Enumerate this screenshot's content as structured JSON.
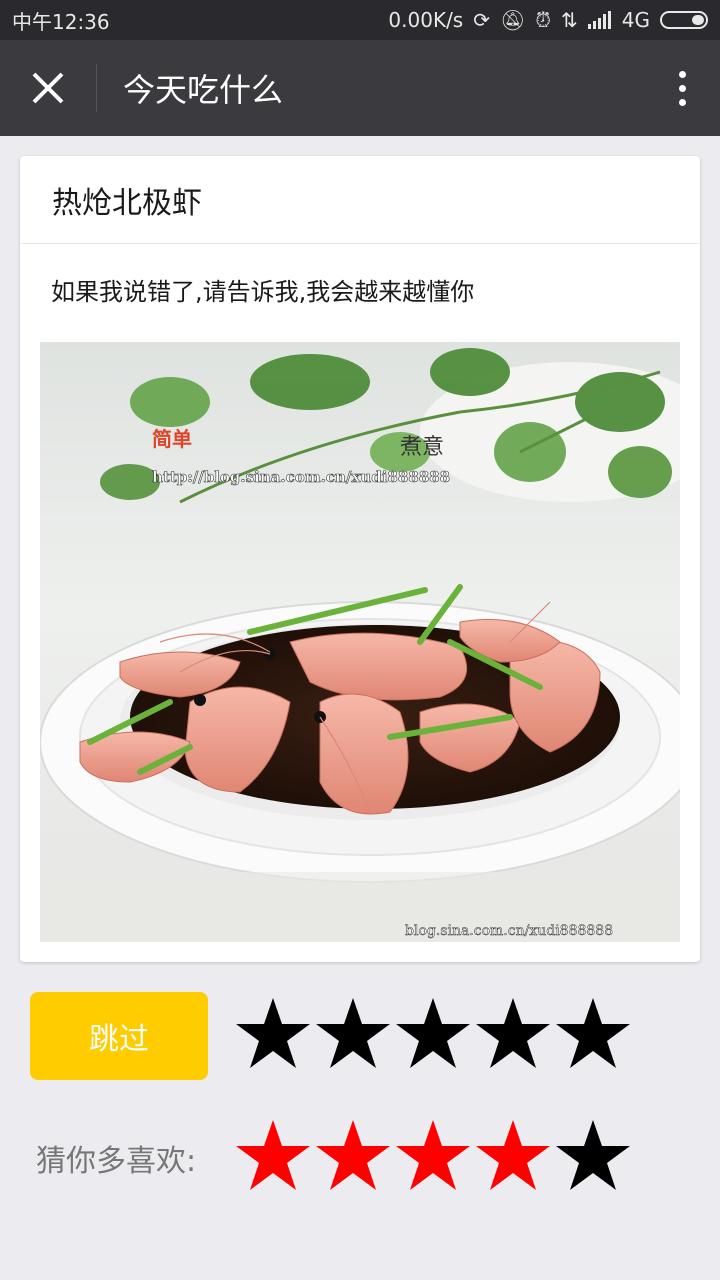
{
  "status_bar": {
    "time": "中午12:36",
    "network_speed": "0.00K/s",
    "network_type": "4G",
    "icons": [
      "sync-icon",
      "mute-icon",
      "alarm-icon",
      "data-arrows-icon",
      "signal-icon",
      "battery-icon"
    ]
  },
  "header": {
    "title": "今天吃什么",
    "close_icon": "close-icon",
    "more_icon": "more-vertical-icon"
  },
  "card": {
    "title": "热炝北极虾",
    "subtitle": "如果我说错了,请告诉我,我会越来越懂你",
    "image": {
      "watermark_top": "http://blog.sina.com.cn/xudi888888",
      "watermark_bottom": "blog.sina.com.cn/xudi888888"
    }
  },
  "actions": {
    "skip_label": "跳过",
    "rating_stars": 5,
    "rating_value": 0
  },
  "recommendation": {
    "label": "猜你多喜欢:",
    "stars_total": 5,
    "stars_filled": 4
  },
  "colors": {
    "star_filled": "#ff0000",
    "star_empty": "#000000",
    "skip_button": "#ffcc00"
  }
}
